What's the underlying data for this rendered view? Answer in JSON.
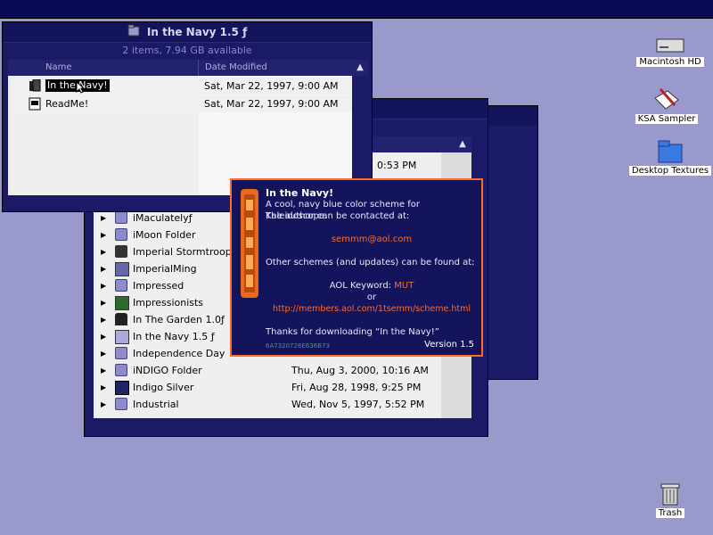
{
  "front_window": {
    "title": "In the Navy 1.5 ƒ",
    "info": "2 items, 7.94 GB available",
    "col_name": "Name",
    "col_date": "Date Modified",
    "sort_arrow": "▲",
    "rows": [
      {
        "name": "In the Navy!",
        "date": "Sat, Mar 22, 1997, 9:00 AM"
      },
      {
        "name": "ReadMe!",
        "date": "Sat, Mar 22, 1997, 9:00 AM"
      }
    ]
  },
  "back_window": {
    "partial_time": "0:53 PM",
    "rows": [
      {
        "name": "iMaculatelyƒ",
        "date": ""
      },
      {
        "name": "iMoon Folder",
        "date": ""
      },
      {
        "name": "Imperial Stormtrooper",
        "date": ""
      },
      {
        "name": "ImperialMing",
        "date": ""
      },
      {
        "name": "Impressed",
        "date": ""
      },
      {
        "name": "Impressionists",
        "date": ""
      },
      {
        "name": "In The Garden 1.0ƒ",
        "date": ""
      },
      {
        "name": "In the Navy 1.5 ƒ",
        "date": ""
      },
      {
        "name": "Independence Day",
        "date": ""
      },
      {
        "name": "iNDIGO Folder",
        "date": "Thu, Aug 3, 2000, 10:16 AM"
      },
      {
        "name": "Indigo Silver",
        "date": "Fri, Aug 28, 1998, 9:25 PM"
      },
      {
        "name": "Industrial",
        "date": "Wed, Nov 5, 1997, 5:52 PM"
      }
    ]
  },
  "about": {
    "title": "In the Navy!",
    "line1": "A cool, navy blue color scheme for Kaleidoscope.",
    "line2": "The author can be contacted at:",
    "email": "semmm@aol.com",
    "line3": "Other schemes (and updates) can be found at:",
    "aol_label": "AOL Keyword:",
    "aol_keyword": "MUT",
    "or": "or",
    "url": "http://members.aol.com/1tsemm/scheme.html",
    "thanks": "Thanks for downloading “In the Navy!”",
    "serial": "6A7320726E636B73",
    "version": "Version 1.5"
  },
  "desktop": {
    "icons": [
      {
        "label": "Macintosh HD"
      },
      {
        "label": "KSA Sampler"
      },
      {
        "label": "Desktop Textures"
      },
      {
        "label": "Trash"
      }
    ]
  }
}
